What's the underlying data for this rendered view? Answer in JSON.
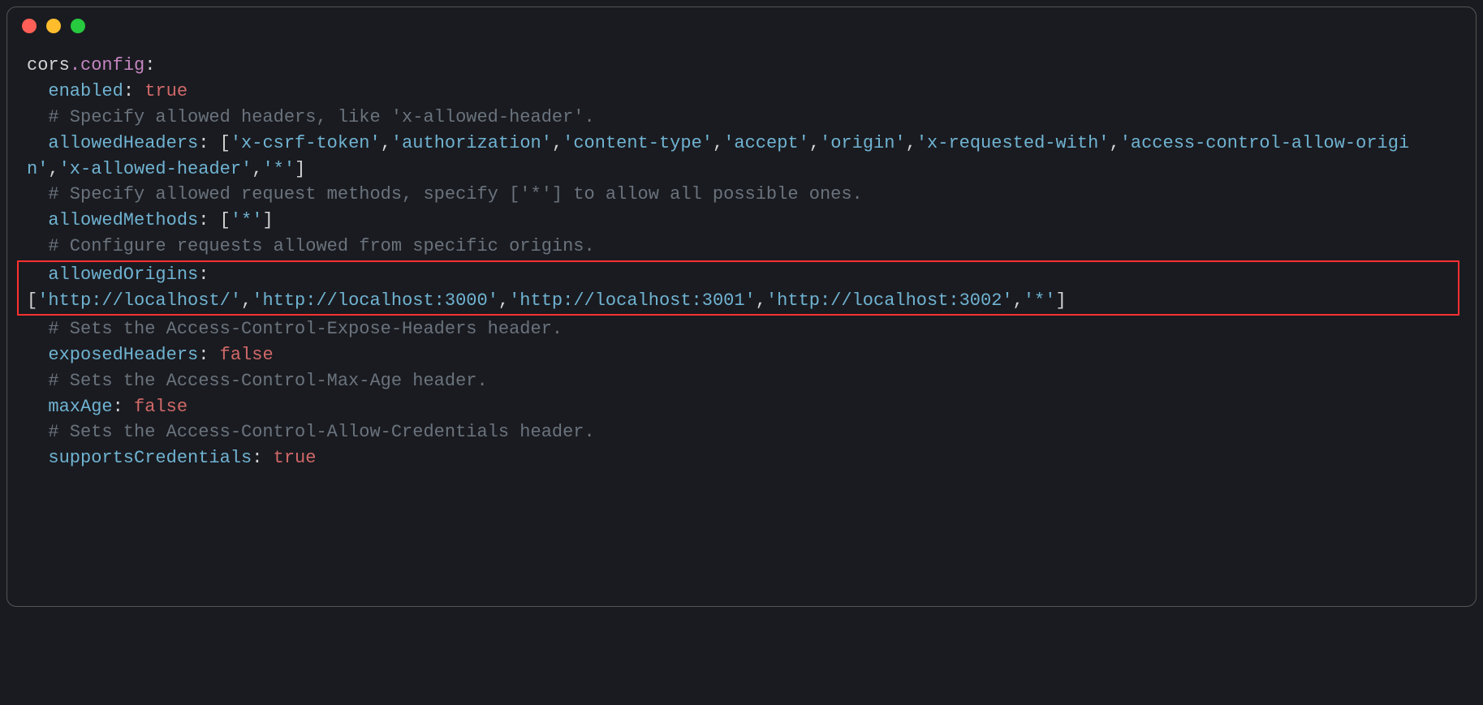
{
  "titlebar": {
    "buttons": [
      "close",
      "minimize",
      "maximize"
    ]
  },
  "code": {
    "line1_a": "cors",
    "line1_b": ".config",
    "line1_c": ":",
    "enabled_key": "enabled",
    "enabled_val": "true",
    "comment_headers": "# Specify allowed headers, like 'x-allowed-header'.",
    "allowedHeaders_key": "allowedHeaders",
    "allowedHeaders_open": "[",
    "allowedHeaders_items": [
      "'x-csrf-token'",
      "'authorization'",
      "'content-type'",
      "'accept'",
      "'origin'",
      "'x-requested-with'",
      "'access-control-allow-origin'",
      "'x-allowed-header'",
      "'*'"
    ],
    "allowedHeaders_close": "]",
    "comment_methods": "# Specify allowed request methods, specify ['*'] to allow all possible ones.",
    "allowedMethods_key": "allowedMethods",
    "allowedMethods_open": "[",
    "allowedMethods_items": [
      "'*'"
    ],
    "allowedMethods_close": "]",
    "comment_origins": "# Configure requests allowed from specific origins.",
    "allowedOrigins_key": "allowedOrigins",
    "allowedOrigins_open": "[",
    "allowedOrigins_items": [
      "'http://localhost/'",
      "'http://localhost:3000'",
      "'http://localhost:3001'",
      "'http://localhost:3002'",
      "'*'"
    ],
    "allowedOrigins_close": "]",
    "comment_expose": "# Sets the Access-Control-Expose-Headers header.",
    "exposedHeaders_key": "exposedHeaders",
    "exposedHeaders_val": "false",
    "comment_maxage": "# Sets the Access-Control-Max-Age header.",
    "maxAge_key": "maxAge",
    "maxAge_val": "false",
    "comment_creds": "# Sets the Access-Control-Allow-Credentials header.",
    "supportsCredentials_key": "supportsCredentials",
    "supportsCredentials_val": "true",
    "colon_space": ": ",
    "comma": ",",
    "colon": ":"
  }
}
